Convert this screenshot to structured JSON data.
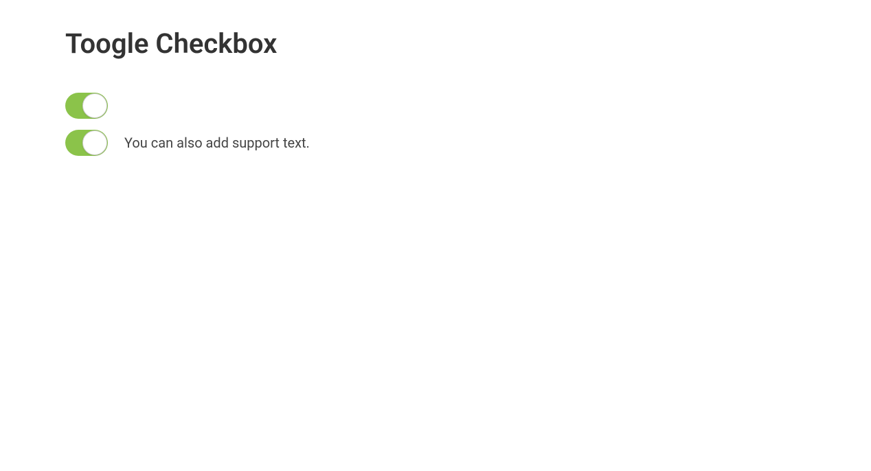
{
  "page": {
    "title": "Toogle Checkbox"
  },
  "toggles": [
    {
      "checked": true,
      "label": ""
    },
    {
      "checked": true,
      "label": "You can also add support text."
    }
  ],
  "colors": {
    "toggleOn": "#8bc34a",
    "text": "#333333"
  }
}
